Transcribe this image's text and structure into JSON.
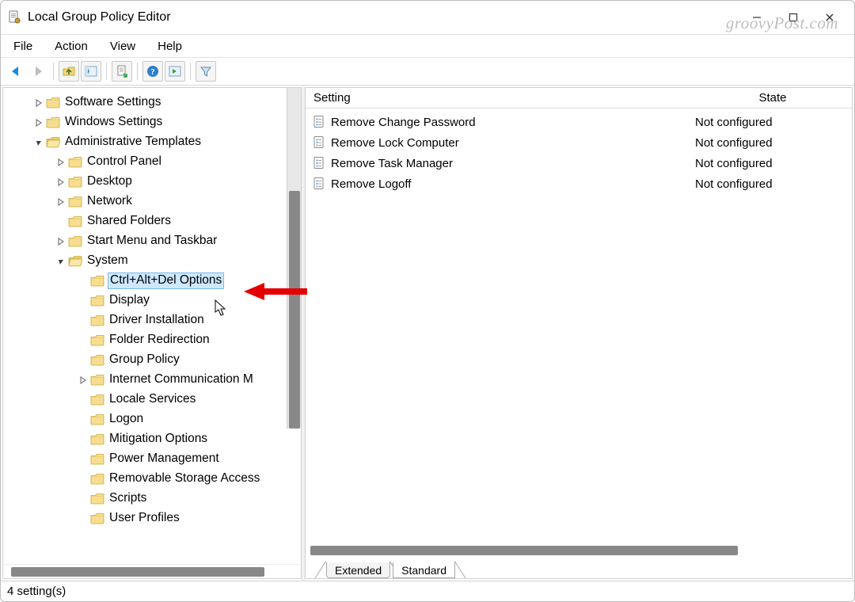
{
  "window": {
    "title": "Local Group Policy Editor"
  },
  "watermark": "groovyPost.com",
  "menu": {
    "file": "File",
    "action": "Action",
    "view": "View",
    "help": "Help"
  },
  "tree": {
    "items": [
      {
        "label": "Software Settings",
        "depth": 1,
        "twisty": "closed"
      },
      {
        "label": "Windows Settings",
        "depth": 1,
        "twisty": "closed"
      },
      {
        "label": "Administrative Templates",
        "depth": 1,
        "twisty": "open"
      },
      {
        "label": "Control Panel",
        "depth": 2,
        "twisty": "closed"
      },
      {
        "label": "Desktop",
        "depth": 2,
        "twisty": "closed"
      },
      {
        "label": "Network",
        "depth": 2,
        "twisty": "closed"
      },
      {
        "label": "Shared Folders",
        "depth": 2,
        "twisty": "none"
      },
      {
        "label": "Start Menu and Taskbar",
        "depth": 2,
        "twisty": "closed"
      },
      {
        "label": "System",
        "depth": 2,
        "twisty": "open"
      },
      {
        "label": "Ctrl+Alt+Del Options",
        "depth": 3,
        "twisty": "none",
        "selected": true
      },
      {
        "label": "Display",
        "depth": 3,
        "twisty": "none"
      },
      {
        "label": "Driver Installation",
        "depth": 3,
        "twisty": "none"
      },
      {
        "label": "Folder Redirection",
        "depth": 3,
        "twisty": "none"
      },
      {
        "label": "Group Policy",
        "depth": 3,
        "twisty": "none"
      },
      {
        "label": "Internet Communication M",
        "depth": 3,
        "twisty": "closed"
      },
      {
        "label": "Locale Services",
        "depth": 3,
        "twisty": "none"
      },
      {
        "label": "Logon",
        "depth": 3,
        "twisty": "none"
      },
      {
        "label": "Mitigation Options",
        "depth": 3,
        "twisty": "none"
      },
      {
        "label": "Power Management",
        "depth": 3,
        "twisty": "none"
      },
      {
        "label": "Removable Storage Access",
        "depth": 3,
        "twisty": "none"
      },
      {
        "label": "Scripts",
        "depth": 3,
        "twisty": "none"
      },
      {
        "label": "User Profiles",
        "depth": 3,
        "twisty": "none"
      }
    ]
  },
  "list": {
    "columns": {
      "setting": "Setting",
      "state": "State"
    },
    "rows": [
      {
        "name": "Remove Change Password",
        "state": "Not configured"
      },
      {
        "name": "Remove Lock Computer",
        "state": "Not configured"
      },
      {
        "name": "Remove Task Manager",
        "state": "Not configured"
      },
      {
        "name": "Remove Logoff",
        "state": "Not configured"
      }
    ]
  },
  "tabs": {
    "extended": "Extended",
    "standard": "Standard"
  },
  "statusbar": {
    "text": "4 setting(s)"
  }
}
